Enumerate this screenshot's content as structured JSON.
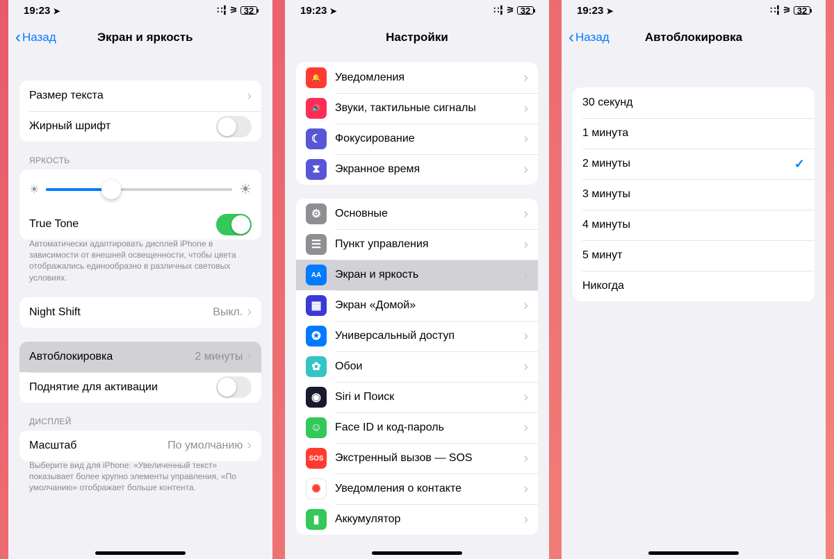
{
  "status": {
    "time": "19:23",
    "battery": "32"
  },
  "phone1": {
    "back": "Назад",
    "title": "Экран и яркость",
    "text_size": "Размер текста",
    "bold_text": "Жирный шрифт",
    "brightness_header": "ЯРКОСТЬ",
    "brightness_percent": 35,
    "true_tone": "True Tone",
    "true_tone_note": "Автоматически адаптировать дисплей iPhone в зависимости от внешней освещенности, чтобы цвета отображались единообразно в различных световых условиях.",
    "night_shift": "Night Shift",
    "night_shift_value": "Выкл.",
    "autolock": "Автоблокировка",
    "autolock_value": "2 минуты",
    "raise_wake": "Поднятие для активации",
    "display_header": "ДИСПЛЕЙ",
    "zoom": "Масштаб",
    "zoom_value": "По умолчанию",
    "zoom_note": "Выберите вид для iPhone: «Увеличенный текст» показывает более крупно элементы управления, «По умолчанию» отображает больше контента."
  },
  "phone2": {
    "title": "Настройки",
    "items1": [
      {
        "label": "Уведомления",
        "color": "#ff3b30",
        "glyph": "🔔"
      },
      {
        "label": "Звуки, тактильные сигналы",
        "color": "#ff2d55",
        "glyph": "🔊"
      },
      {
        "label": "Фокусирование",
        "color": "#5856d6",
        "glyph": "☾"
      },
      {
        "label": "Экранное время",
        "color": "#5856d6",
        "glyph": "⧗"
      }
    ],
    "items2": [
      {
        "label": "Основные",
        "color": "#8e8e93",
        "glyph": "⚙"
      },
      {
        "label": "Пункт управления",
        "color": "#8e8e93",
        "glyph": "☰"
      },
      {
        "label": "Экран и яркость",
        "color": "#007aff",
        "glyph": "AA",
        "selected": true
      },
      {
        "label": "Экран «Домой»",
        "color": "#3a3ad6",
        "glyph": "▦"
      },
      {
        "label": "Универсальный доступ",
        "color": "#007aff",
        "glyph": "✪"
      },
      {
        "label": "Обои",
        "color": "#34c4c4",
        "glyph": "✿"
      },
      {
        "label": "Siri и Поиск",
        "color": "#1a1a2e",
        "glyph": "◉"
      },
      {
        "label": "Face ID и код-пароль",
        "color": "#34c759",
        "glyph": "☺"
      },
      {
        "label": "Экстренный вызов — SOS",
        "color": "#ff3b30",
        "glyph": "SOS"
      },
      {
        "label": "Уведомления о контакте",
        "color": "#ffffff",
        "glyph": "✺",
        "fg": "#ff3b30",
        "border": true
      },
      {
        "label": "Аккумулятор",
        "color": "#34c759",
        "glyph": "▮"
      }
    ]
  },
  "phone3": {
    "back": "Назад",
    "title": "Автоблокировка",
    "options": [
      {
        "label": "30 секунд"
      },
      {
        "label": "1 минута"
      },
      {
        "label": "2 минуты",
        "selected": true
      },
      {
        "label": "3 минуты"
      },
      {
        "label": "4 минуты"
      },
      {
        "label": "5 минут"
      },
      {
        "label": "Никогда"
      }
    ]
  }
}
